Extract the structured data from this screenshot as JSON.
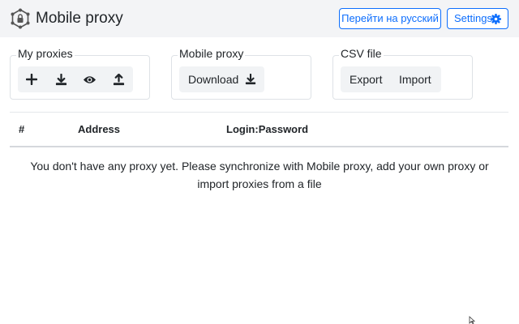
{
  "header": {
    "title": "Mobile proxy",
    "logo_icon": "network-lock-icon",
    "lang_button": "Перейти на русский",
    "settings_button": "Settings",
    "settings_icon": "gear-icon",
    "accent_color": "#0d6efd"
  },
  "groups": {
    "my_proxies": {
      "title": "My proxies",
      "icons": [
        "plus-icon",
        "download-icon",
        "eye-icon",
        "upload-icon"
      ]
    },
    "mobile_proxy": {
      "title": "Mobile proxy",
      "download_label": "Download",
      "download_icon": "download-icon"
    },
    "csv_file": {
      "title": "CSV file",
      "export_label": "Export",
      "import_label": "Import"
    }
  },
  "table": {
    "columns": [
      "#",
      "Address",
      "Login:Password"
    ],
    "empty_message": "You don't have any proxy yet. Please synchronize with Mobile proxy, add your own proxy or import proxies from a file"
  }
}
